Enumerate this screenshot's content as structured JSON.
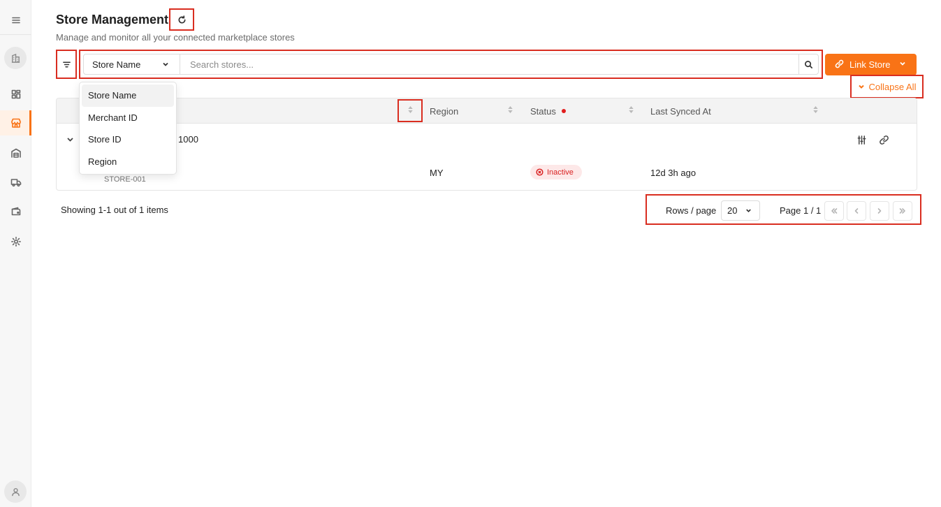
{
  "header": {
    "title": "Store Management",
    "subtitle": "Manage and monitor all your connected marketplace stores"
  },
  "sidebar": {
    "items": [
      {
        "icon": "menu-icon"
      },
      {
        "icon": "building-icon"
      },
      {
        "icon": "dashboard-icon"
      },
      {
        "icon": "store-icon",
        "active": true
      },
      {
        "icon": "warehouse-icon"
      },
      {
        "icon": "truck-icon"
      },
      {
        "icon": "wallet-icon"
      },
      {
        "icon": "gear-icon"
      },
      {
        "icon": "user-icon"
      }
    ]
  },
  "search": {
    "field_selected": "Store Name",
    "placeholder": "Search stores...",
    "field_options": [
      "Store Name",
      "Merchant ID",
      "Store ID",
      "Region"
    ]
  },
  "toolbar": {
    "link_store_label": "Link Store",
    "collapse_all_label": "Collapse All"
  },
  "table": {
    "columns": [
      "Region",
      "Status",
      "Last Synced At"
    ],
    "rows": [
      {
        "name_partial": "1000",
        "store_id": "STORE-001",
        "region": "MY",
        "status": "Inactive",
        "last_synced": "12d 3h ago"
      }
    ]
  },
  "footer": {
    "showing": "Showing 1-1 out of 1 items",
    "rows_label": "Rows / page",
    "rows_per_page": "20",
    "page_info": "Page 1 / 1"
  },
  "colors": {
    "accent": "#f97316",
    "highlight_border": "#d92d20",
    "status_inactive": "#d92020",
    "status_badge_bg": "#fde8e8"
  }
}
